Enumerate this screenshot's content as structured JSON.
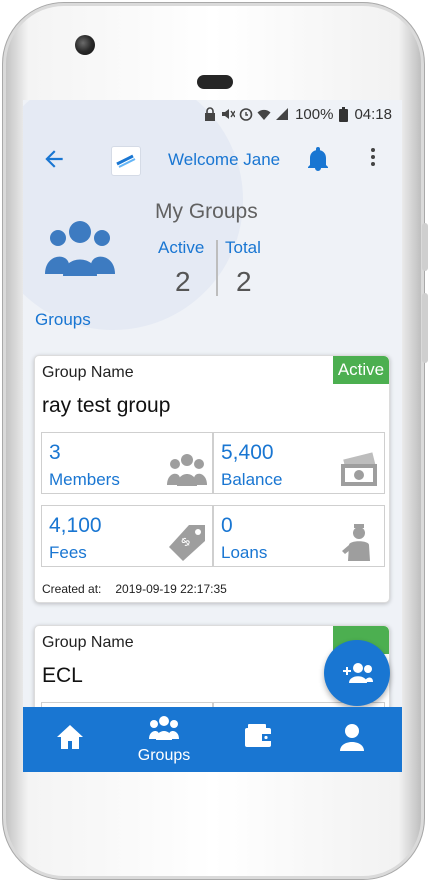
{
  "statusbar": {
    "battery": "100%",
    "time": "04:18"
  },
  "header": {
    "welcome": "Welcome Jane"
  },
  "summary": {
    "title": "My Groups",
    "active_label": "Active",
    "total_label": "Total",
    "active_count": "2",
    "total_count": "2",
    "groups_link": "Groups"
  },
  "groups": [
    {
      "name_label": "Group Name",
      "name": "ray test group",
      "status": "Active",
      "members_value": "3",
      "members_label": "Members",
      "balance_value": "5,400",
      "balance_label": "Balance",
      "fees_value": "4,100",
      "fees_label": "Fees",
      "loans_value": "0",
      "loans_label": "Loans",
      "created_label": "Created at:",
      "created_at": "2019-09-19 22:17:35"
    },
    {
      "name_label": "Group Name",
      "name": "ECL"
    }
  ],
  "nav": {
    "groups_label": "Groups"
  },
  "icons": {
    "back": "arrow-left-icon",
    "bell": "bell-icon",
    "menu": "more-vert-icon",
    "groups": "people-icon",
    "members": "people-icon",
    "balance": "cash-icon",
    "fees": "price-tag-icon",
    "loans": "person-icon",
    "fab": "add-group-icon",
    "nav_home": "home-icon",
    "nav_groups": "people-icon",
    "nav_wallet": "wallet-icon",
    "nav_profile": "person-icon"
  },
  "colors": {
    "primary": "#1976d2",
    "active_badge": "#4caf50"
  }
}
